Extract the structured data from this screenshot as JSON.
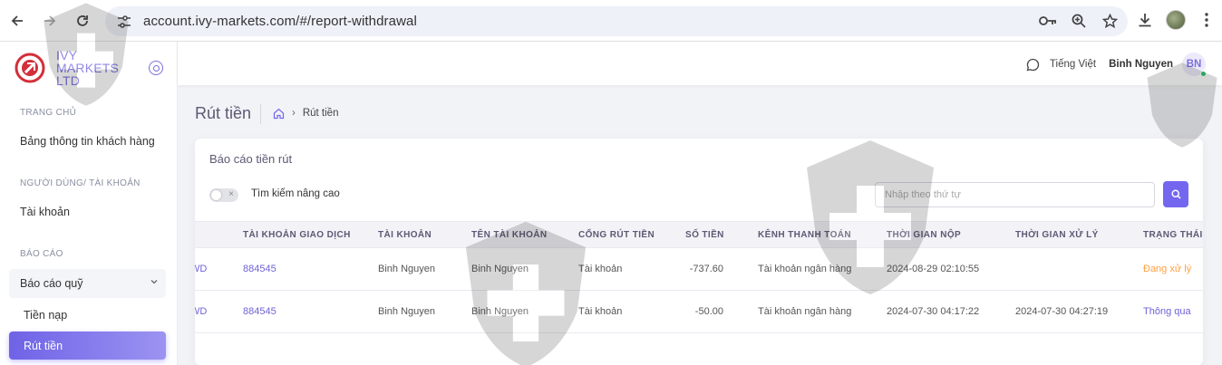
{
  "browser": {
    "url": "account.ivy-markets.com/#/report-withdrawal"
  },
  "brand": {
    "name": "IVY MARKETS LTD"
  },
  "sidebar": {
    "sections": [
      {
        "label": "TRANG CHỦ",
        "items": [
          "Bảng thông tin khách hàng"
        ]
      },
      {
        "label": "NGƯỜI DÙNG/ TÀI KHOẢN",
        "items": [
          "Tài khoản"
        ]
      },
      {
        "label": "BÁO CÁO"
      }
    ],
    "report_group": "Báo cáo quỹ",
    "sub_items": [
      "Tiền nạp",
      "Rút tiền"
    ]
  },
  "header": {
    "language": "Tiếng Việt",
    "username": "Binh Nguyen",
    "avatar_initials": "BN"
  },
  "page": {
    "title": "Rút tiền",
    "breadcrumb_current": "Rút tiền"
  },
  "card": {
    "title": "Báo cáo tiền rút",
    "advanced_search_label": "Tìm kiếm nâng cao",
    "search_placeholder": "Nhập theo thứ tự"
  },
  "table": {
    "columns": [
      "",
      "TÀI KHOẢN GIAO DỊCH",
      "TÀI KHOẢN",
      "TÊN TÀI KHOẢN",
      "CỔNG RÚT TIỀN",
      "SỐ TIỀN",
      "KÊNH THANH TOÁN",
      "THỜI GIAN NỘP",
      "THỜI GIAN XỬ LÝ",
      "TRẠNG THÁI"
    ],
    "rows": [
      [
        "WD",
        "884545",
        "Binh Nguyen",
        "Binh Nguyen",
        "Tài khoản",
        "-737.60",
        "Tài khoản ngân hàng",
        "2024-08-29 02:10:55",
        "",
        "Đang xử lý"
      ],
      [
        "WD",
        "884545",
        "Binh Nguyen",
        "Binh Nguyen",
        "Tài khoản",
        "-50.00",
        "Tài khoản ngân hàng",
        "2024-07-30 04:17:22",
        "2024-07-30 04:27:19",
        "Thông qua"
      ]
    ]
  },
  "colors": {
    "accent": "#7367f0",
    "status_processing": "#ff9f43",
    "brand_red": "#d32f3a"
  }
}
